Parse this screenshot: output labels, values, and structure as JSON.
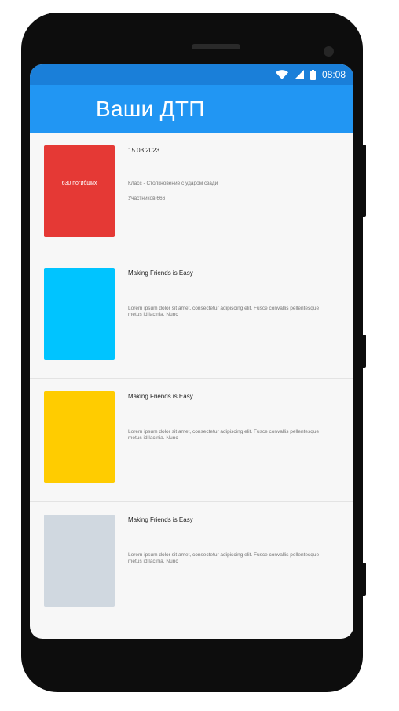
{
  "status_bar": {
    "time": "08:08",
    "icons": [
      "wifi-icon",
      "signal-icon",
      "battery-icon"
    ]
  },
  "app_bar": {
    "title": "Ваши ДТП"
  },
  "colors": {
    "status_bar": "#1a7fd9",
    "app_bar": "#2196f3",
    "thumb_red": "#e53935",
    "thumb_blue": "#00c4ff",
    "thumb_yellow": "#ffcc00",
    "thumb_gray": "#d0d8e0"
  },
  "items": [
    {
      "thumb_color": "#e53935",
      "thumb_text": "630 погибших",
      "title": "15.03.2023",
      "line1": "Класс - Столкновение с ударом сзади",
      "line2": "Участников 666"
    },
    {
      "thumb_color": "#00c4ff",
      "thumb_text": "",
      "title": "Making Friends is Easy",
      "line1": "Lorem ipsum dolor sit amet, consectetur adipiscing elit. Fusce convallis pellentesque metus id lacinia. Nunc",
      "line2": ""
    },
    {
      "thumb_color": "#ffcc00",
      "thumb_text": "",
      "title": "Making Friends is Easy",
      "line1": "Lorem ipsum dolor sit amet, consectetur adipiscing elit. Fusce convallis pellentesque metus id lacinia. Nunc",
      "line2": ""
    },
    {
      "thumb_color": "#d0d8e0",
      "thumb_text": "",
      "title": "Making Friends is Easy",
      "line1": "Lorem ipsum dolor sit amet, consectetur adipiscing elit. Fusce convallis pellentesque metus id lacinia. Nunc",
      "line2": ""
    }
  ]
}
